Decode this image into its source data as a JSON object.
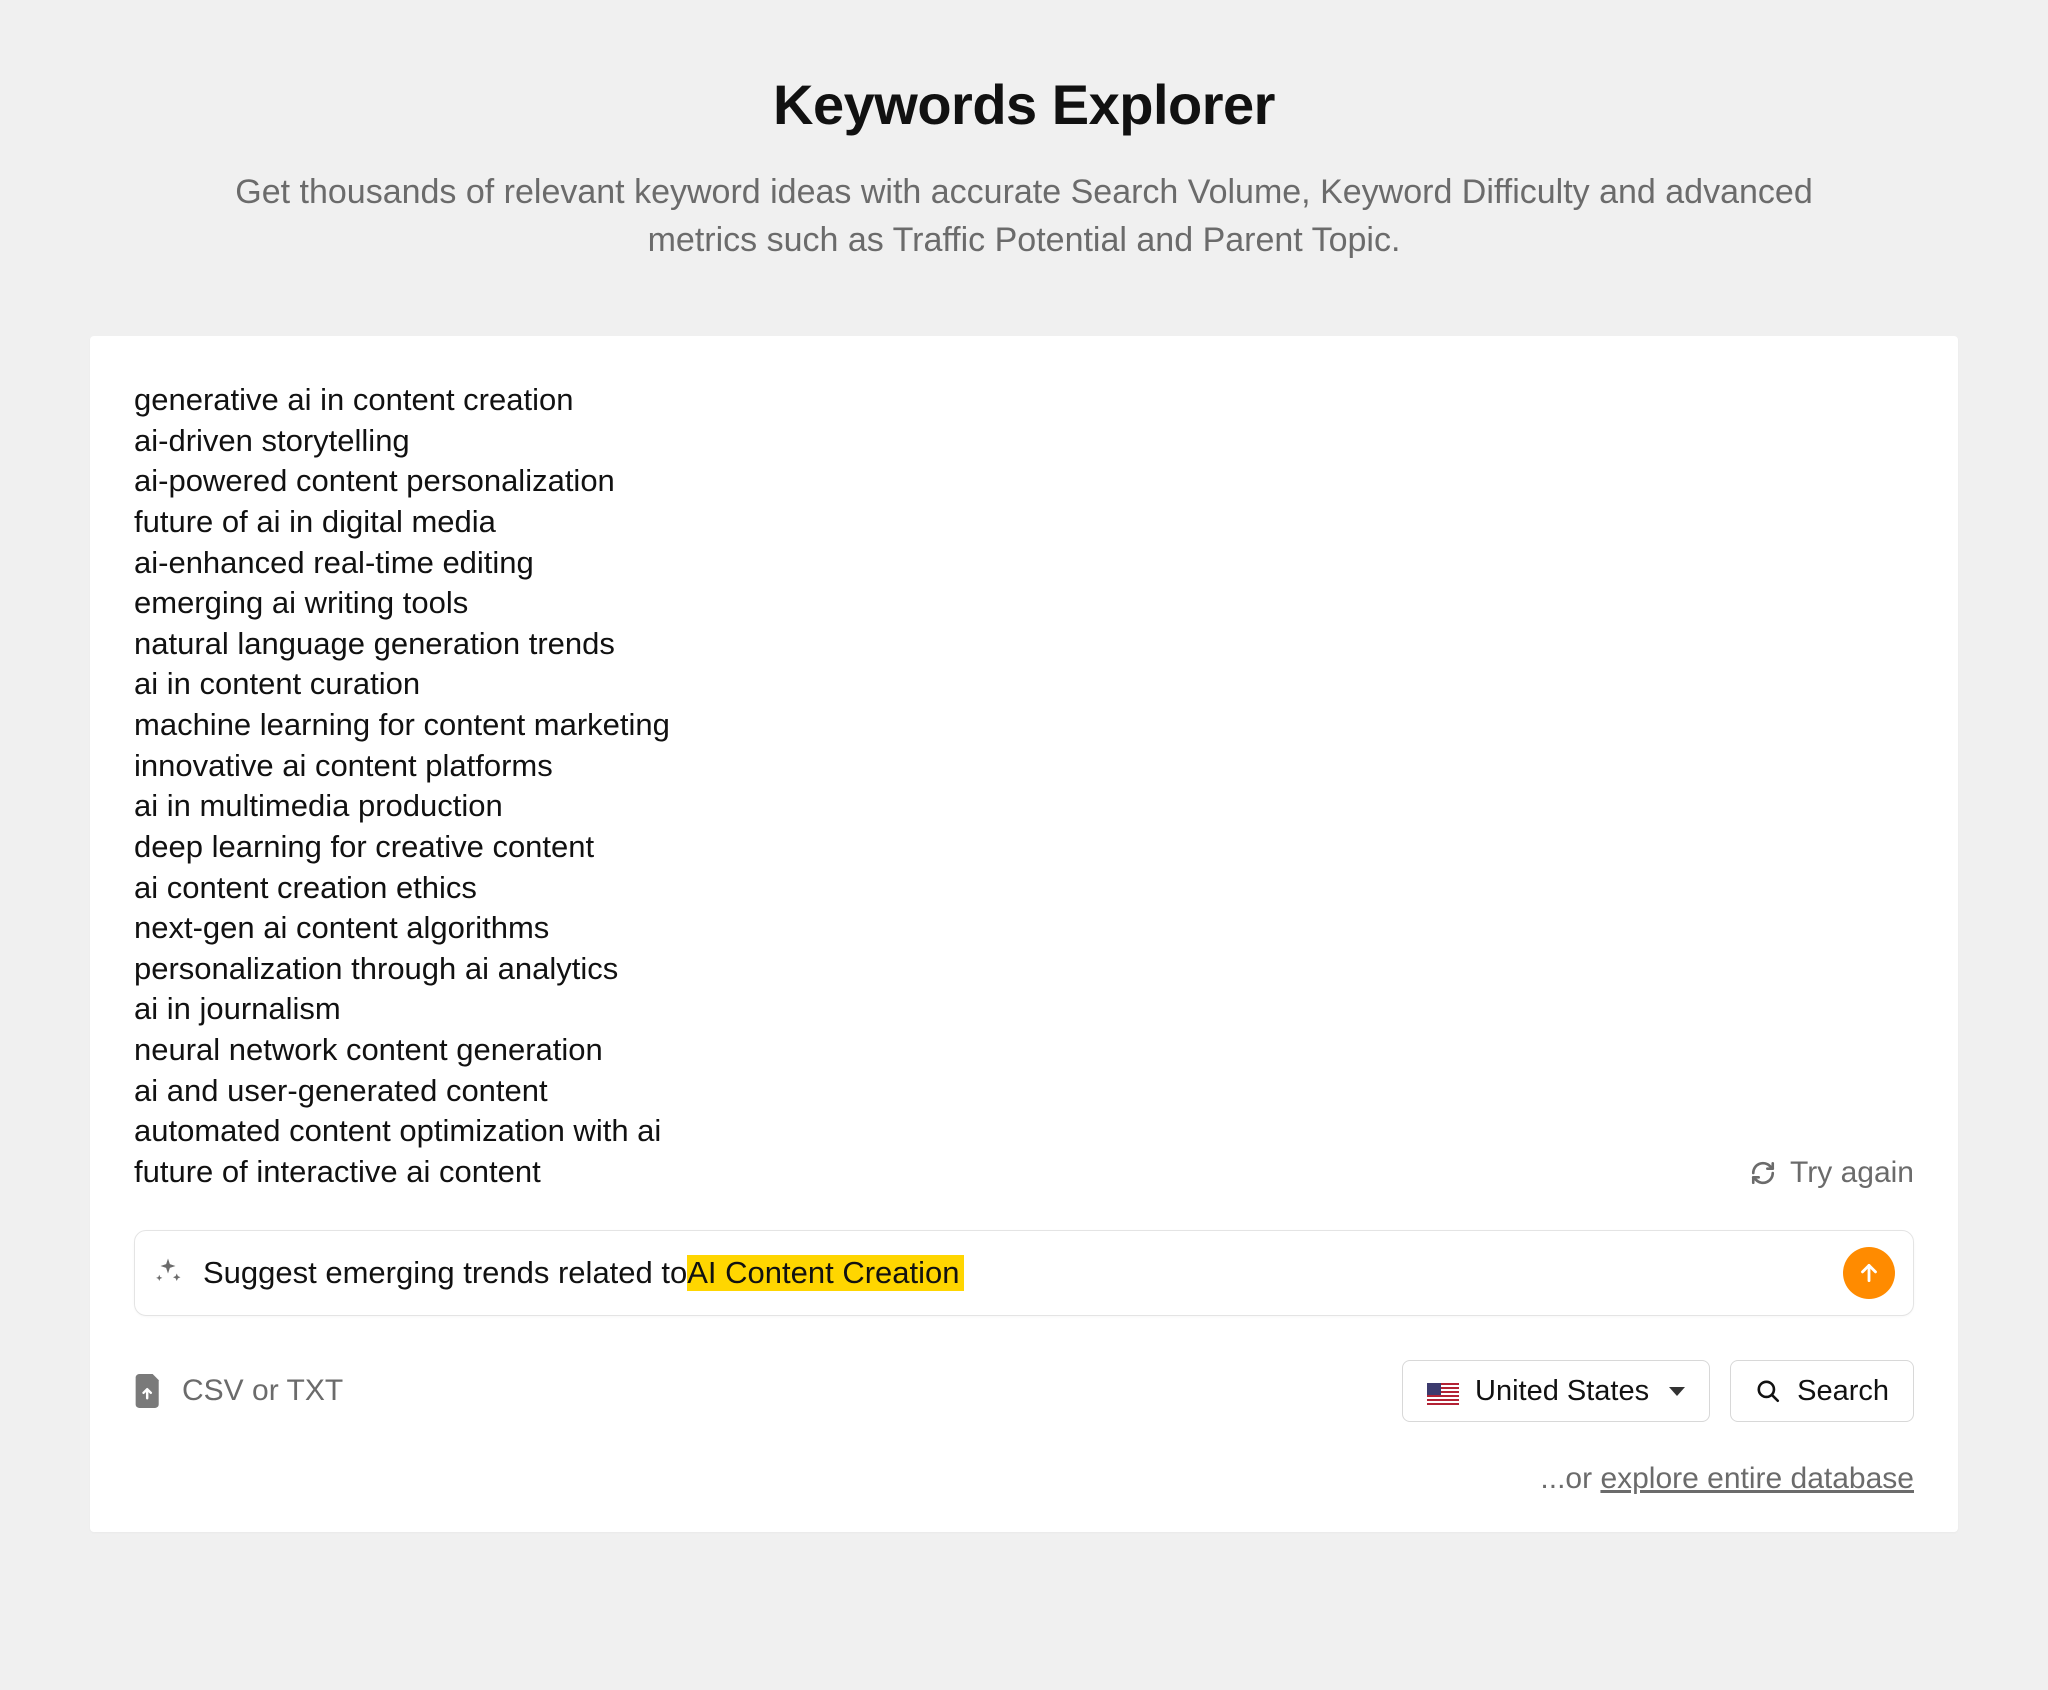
{
  "header": {
    "title": "Keywords Explorer",
    "subtitle": "Get thousands of relevant keyword ideas with accurate Search Volume, Keyword Difficulty and advanced metrics such as Traffic Potential and Parent Topic."
  },
  "keywords": [
    "generative ai in content creation",
    "ai-driven storytelling",
    "ai-powered content personalization",
    "future of ai in digital media",
    "ai-enhanced real-time editing",
    "emerging ai writing tools",
    "natural language generation trends",
    "ai in content curation",
    "machine learning for content marketing",
    "innovative ai content platforms",
    "ai in multimedia production",
    "deep learning for creative content",
    "ai content creation ethics",
    "next-gen ai content algorithms",
    "personalization through ai analytics",
    "ai in journalism",
    "neural network content generation",
    "ai and user-generated content",
    "automated content optimization with ai",
    "future of interactive ai content"
  ],
  "try_again_label": "Try again",
  "suggest": {
    "prefix": "Suggest emerging trends related to ",
    "highlighted": "AI Content Creation"
  },
  "upload_label": "CSV or TXT",
  "country": {
    "name": "United States",
    "flag_icon": "us-flag"
  },
  "search_label": "Search",
  "explore": {
    "prefix": "...or ",
    "link": "explore entire database"
  },
  "icons": {
    "refresh": "refresh-icon",
    "sparkle": "sparkle-icon",
    "send": "arrow-up-icon",
    "upload": "file-upload-icon",
    "search": "search-icon",
    "caret": "caret-down-icon"
  }
}
